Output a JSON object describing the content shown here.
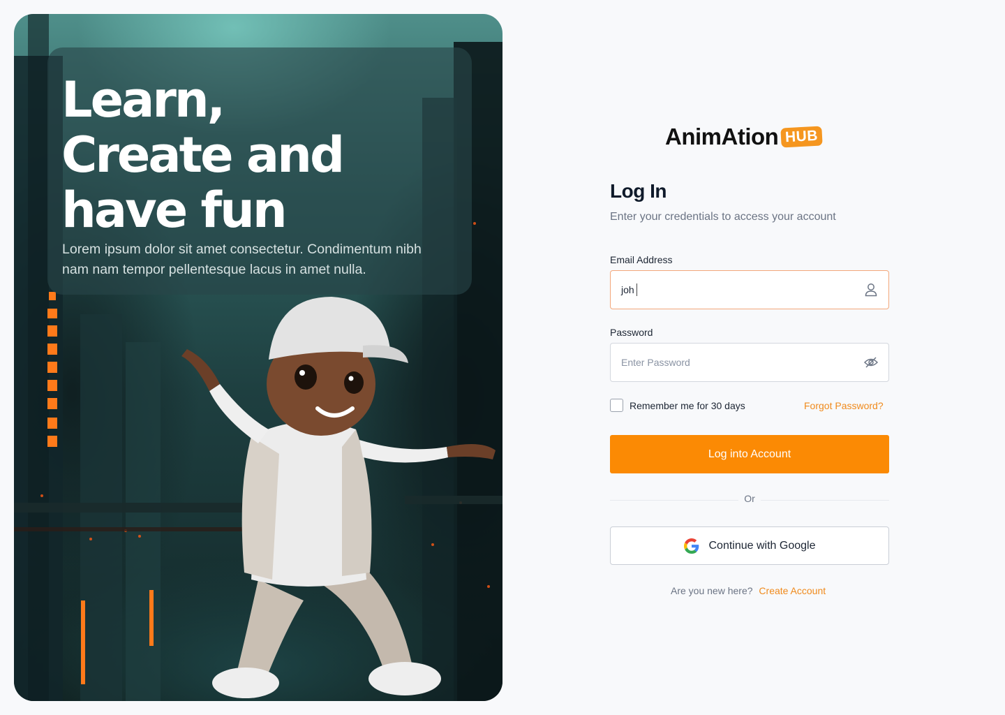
{
  "hero": {
    "headline_line1": "Learn,",
    "headline_line2": "Create and",
    "headline_line3": "have fun",
    "subtext": "Lorem ipsum dolor sit amet consectetur. Condimentum nibh nam nam tempor pellentesque lacus in amet nulla."
  },
  "logo": {
    "word": "AnimAtion",
    "badge": "HUB"
  },
  "form": {
    "title": "Log In",
    "subtitle": "Enter your credentials to access your account",
    "email_label": "Email Address",
    "email_value": "joh",
    "email_icon": "user-icon",
    "password_label": "Password",
    "password_placeholder": "Enter Password",
    "password_icon": "eye-off-icon",
    "remember_label": "Remember me for 30 days",
    "remember_checked": false,
    "forgot_link": "Forgot Password?",
    "submit_label": "Log into Account",
    "divider_text": "Or",
    "google_label": "Continue with Google",
    "signup_prompt": "Are you new here?",
    "signup_link": "Create Account"
  },
  "colors": {
    "accent": "#fb8a04",
    "link": "#f08a1c",
    "background": "#f8f9fb",
    "text_primary": "#0f1a2a",
    "text_muted": "#6b7484"
  }
}
